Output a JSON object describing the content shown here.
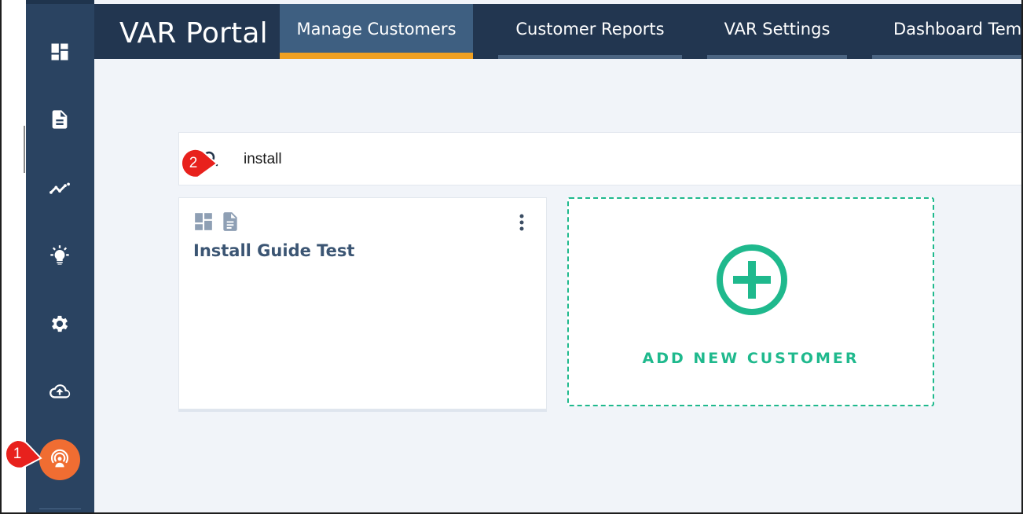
{
  "brand": "VAR Portal",
  "tabs": [
    {
      "label": "Manage Customers",
      "active": true
    },
    {
      "label": "Customer Reports",
      "active": false
    },
    {
      "label": "VAR Settings",
      "active": false
    },
    {
      "label": "Dashboard Temp",
      "active": false
    }
  ],
  "sidebar": {
    "items": [
      {
        "icon": "dashboard-icon"
      },
      {
        "icon": "document-icon"
      },
      {
        "icon": "trend-line-icon"
      },
      {
        "icon": "lightbulb-icon"
      },
      {
        "icon": "gear-icon"
      },
      {
        "icon": "cloud-upload-icon"
      },
      {
        "icon": "broadcast-user-icon",
        "active": true
      }
    ]
  },
  "search": {
    "value": "install"
  },
  "customers": [
    {
      "name": "Install Guide Test",
      "icons": [
        "dashboard-icon",
        "document-icon"
      ]
    }
  ],
  "add_customer": {
    "label": "ADD NEW CUSTOMER"
  },
  "callouts": [
    "1",
    "2"
  ],
  "colors": {
    "sidebar": "#2a4361",
    "topbar": "#223650",
    "active_tab": "#3e5f81",
    "tab_accent": "#f0a021",
    "active_sidebar": "#f06d32",
    "add_accent": "#1fb98d",
    "callout": "#e8211d"
  }
}
